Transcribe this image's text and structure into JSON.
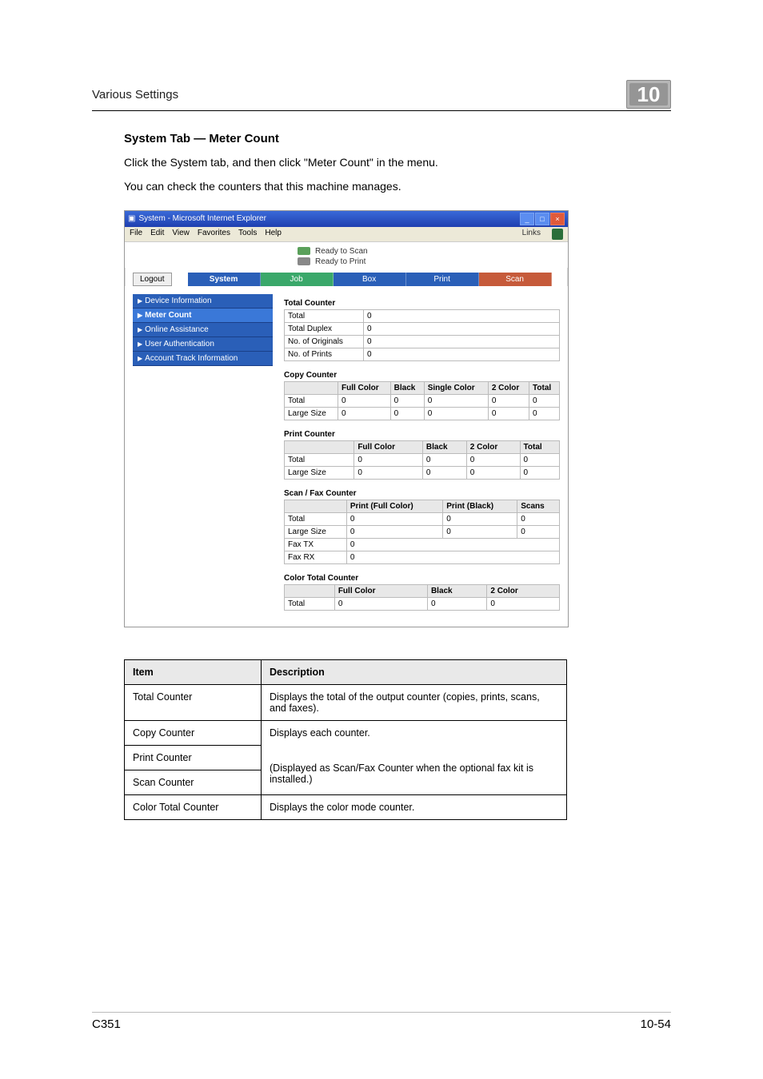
{
  "header": {
    "section": "Various Settings",
    "chapter": "10"
  },
  "section_title": "System Tab — Meter Count",
  "paragraph1": "Click the System tab, and then click \"Meter Count\" in the menu.",
  "paragraph2": "You can check the counters that this machine manages.",
  "ie_window": {
    "title": "System - Microsoft Internet Explorer",
    "menus": [
      "File",
      "Edit",
      "View",
      "Favorites",
      "Tools",
      "Help"
    ],
    "links_label": "Links"
  },
  "status": {
    "scan": "Ready to Scan",
    "print": "Ready to Print"
  },
  "logout": "Logout",
  "tabs": {
    "system": "System",
    "job": "Job",
    "box": "Box",
    "print": "Print",
    "scan": "Scan"
  },
  "sidebar": {
    "items": [
      {
        "label": "Device Information"
      },
      {
        "label": "Meter Count"
      },
      {
        "label": "Online Assistance"
      },
      {
        "label": "User Authentication"
      },
      {
        "label": "Account Track Information"
      }
    ]
  },
  "total_counter": {
    "title": "Total Counter",
    "rows": [
      {
        "label": "Total",
        "value": "0"
      },
      {
        "label": "Total Duplex",
        "value": "0"
      },
      {
        "label": "No. of Originals",
        "value": "0"
      },
      {
        "label": "No. of Prints",
        "value": "0"
      }
    ]
  },
  "copy_counter": {
    "title": "Copy Counter",
    "cols": [
      "Full Color",
      "Black",
      "Single Color",
      "2 Color",
      "Total"
    ],
    "rows": [
      {
        "label": "Total",
        "v": [
          "0",
          "0",
          "0",
          "0",
          "0"
        ]
      },
      {
        "label": "Large Size",
        "v": [
          "0",
          "0",
          "0",
          "0",
          "0"
        ]
      }
    ]
  },
  "print_counter": {
    "title": "Print Counter",
    "cols": [
      "Full Color",
      "Black",
      "2 Color",
      "Total"
    ],
    "rows": [
      {
        "label": "Total",
        "v": [
          "0",
          "0",
          "0",
          "0"
        ]
      },
      {
        "label": "Large Size",
        "v": [
          "0",
          "0",
          "0",
          "0"
        ]
      }
    ]
  },
  "scanfax_counter": {
    "title": "Scan / Fax Counter",
    "cols": [
      "Print (Full Color)",
      "Print (Black)",
      "Scans"
    ],
    "rows": [
      {
        "label": "Total",
        "v": [
          "0",
          "0",
          "0"
        ]
      },
      {
        "label": "Large Size",
        "v": [
          "0",
          "0",
          "0"
        ]
      }
    ],
    "fax_rows": [
      {
        "label": "Fax TX",
        "value": "0"
      },
      {
        "label": "Fax RX",
        "value": "0"
      }
    ]
  },
  "color_total_counter": {
    "title": "Color Total Counter",
    "cols": [
      "Full Color",
      "Black",
      "2 Color"
    ],
    "rows": [
      {
        "label": "Total",
        "v": [
          "0",
          "0",
          "0"
        ]
      }
    ]
  },
  "desc_table": {
    "head": {
      "item": "Item",
      "desc": "Description"
    },
    "rows": [
      {
        "item": "Total Counter",
        "desc": "Displays the total of the output counter (copies, prints, scans, and faxes)."
      },
      {
        "item": "Copy Counter",
        "desc": "Displays each counter."
      },
      {
        "item": "Print Counter",
        "desc": ""
      },
      {
        "item": "Scan Counter",
        "desc": "(Displayed as Scan/Fax Counter when the optional fax kit is installed.)"
      },
      {
        "item": "Color Total Counter",
        "desc": "Displays the color mode counter."
      }
    ]
  },
  "footer": {
    "left": "C351",
    "right": "10-54"
  }
}
